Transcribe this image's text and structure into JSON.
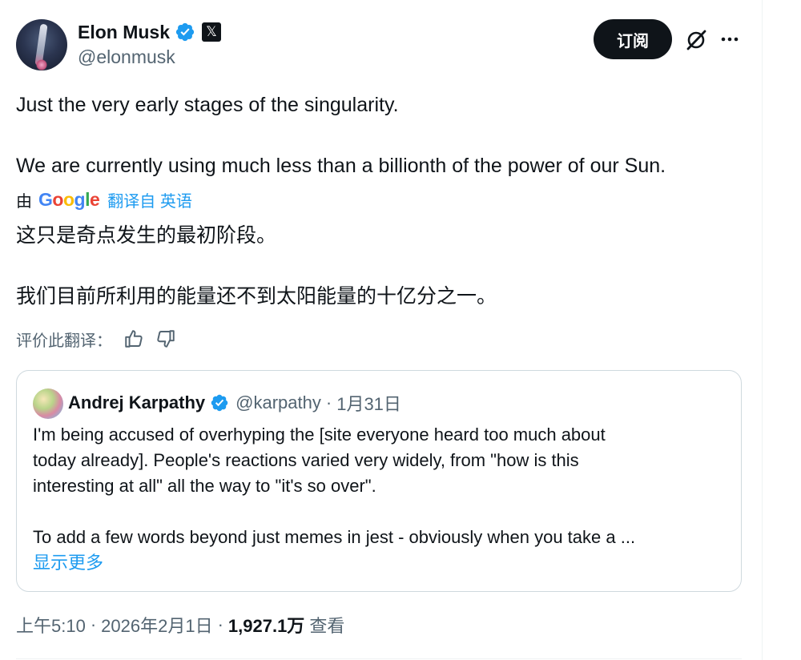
{
  "author": {
    "display_name": "Elon Musk",
    "handle": "@elonmusk",
    "verified": true,
    "badge_icon": "x-logo-icon"
  },
  "actions": {
    "subscribe_label": "订阅",
    "grok_icon": "grok-icon",
    "more_icon": "more-icon"
  },
  "tweet": {
    "line1": "Just the very early stages of the singularity.",
    "line2": "We are currently using much less than a billionth of the power of our Sun."
  },
  "translation": {
    "by_label": "由",
    "provider": "Google",
    "translated_from": "翻译自 英语",
    "line1": "这只是奇点发生的最初阶段。",
    "line2": "我们目前所利用的能量还不到太阳能量的十亿分之一。",
    "rate_label": "评价此翻译："
  },
  "quote": {
    "display_name": "Andrej Karpathy",
    "handle": "@karpathy",
    "separator": "·",
    "date": "1月31日",
    "verified": true,
    "lines": [
      "I'm being accused of overhyping the [site everyone heard too much about",
      "today already]. People's reactions varied very widely, from \"how is this",
      "interesting at all\" all the way to \"it's so over\".",
      "To add a few words beyond just memes in jest - obviously when you take a ..."
    ],
    "show_more": "显示更多"
  },
  "meta": {
    "time": "上午5:10",
    "separator": "·",
    "date": "2026年2月1日",
    "views_count": "1,927.1万",
    "views_label": "查看"
  },
  "colors": {
    "text": "#0f1419",
    "muted": "#536471",
    "accent": "#1d9bf0",
    "border": "#cfd9de"
  }
}
